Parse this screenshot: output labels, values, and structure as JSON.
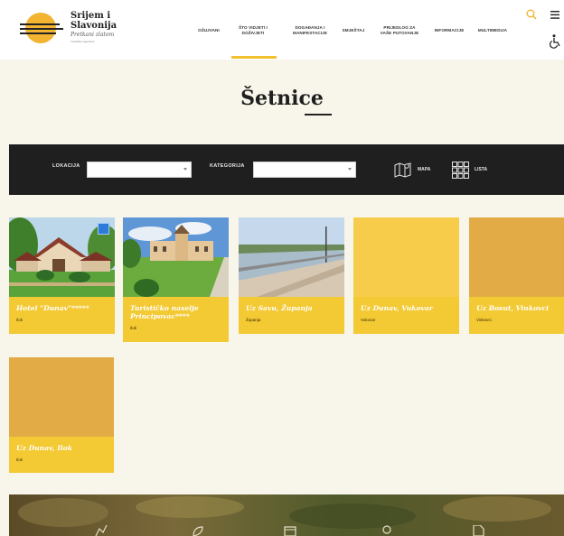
{
  "logo": {
    "title_line1": "Srijem i",
    "title_line2": "Slavonija",
    "subtitle": "Pretkani zlatom",
    "fine_print": "Turistička zajednica"
  },
  "nav": {
    "items": [
      {
        "label": "OŽUJVANI"
      },
      {
        "label": "ŠTO VIDJETI I",
        "label2": "DOŽIVJETI"
      },
      {
        "label": "DOGAĐANJA I",
        "label2": "MANIFESTACIJE"
      },
      {
        "label": "SMJEŠTAJ"
      },
      {
        "label": "PRIJEDLOG ZA",
        "label2": "VAŠE PUTOVANJE"
      },
      {
        "label": "INFORMACIJE"
      },
      {
        "label": "MULTIMEDIJA"
      }
    ]
  },
  "page": {
    "title": "Šetnice"
  },
  "filters": {
    "location_label": "LOKACIJA",
    "category_label": "KATEGORIJA",
    "map_label": "MAPA",
    "list_label": "LISTA"
  },
  "cards": [
    {
      "title": "Hotel \"Dunav\"*****",
      "location": "Ilok"
    },
    {
      "title": "Turističko naselje Principovac****",
      "location": "Ilok"
    },
    {
      "title": "Uz Savu, Županja",
      "location": "Županja"
    },
    {
      "title": "Uz Dunav, Vukovar",
      "location": "Vukovar"
    },
    {
      "title": "Uz Bosut, Vinkovci",
      "location": "Vinkovci"
    },
    {
      "title": "Uz Dunav, Ilok",
      "location": "Ilok"
    }
  ],
  "colors": {
    "accent": "#f2c12e",
    "card_yellow": "#f3c934",
    "card_placeholder_light": "#f6cc4a",
    "card_placeholder_dark": "#e2ab45",
    "filter_bar": "#1f1f1f",
    "page_bg": "#f8f5ea"
  },
  "icons": {
    "search": "search-icon",
    "menu": "hamburger-menu-icon",
    "accessibility": "wheelchair-icon",
    "map": "map-icon",
    "list": "grid-list-icon"
  }
}
